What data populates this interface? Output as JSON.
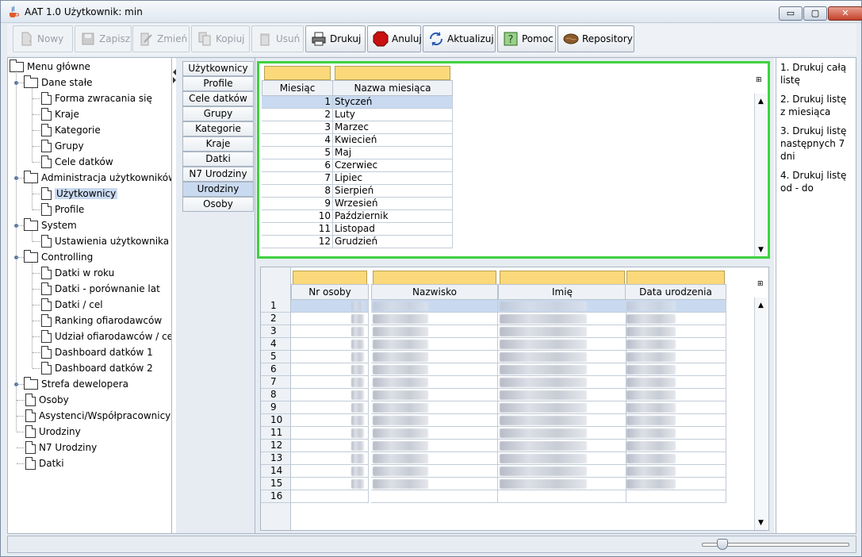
{
  "window": {
    "title": "AAT 1.0  Użytkownik: min",
    "minimize": "▭",
    "maximize": "▢",
    "close": "✕"
  },
  "toolbar": [
    {
      "label": "Nowy",
      "icon": "new-icon",
      "enabled": false
    },
    {
      "label": "Zapisz",
      "icon": "save-icon",
      "enabled": false
    },
    {
      "label": "Zmień",
      "icon": "edit-icon",
      "enabled": false
    },
    {
      "label": "Kopiuj",
      "icon": "copy-icon",
      "enabled": false
    },
    {
      "label": "Usuń",
      "icon": "delete-icon",
      "enabled": false
    },
    {
      "label": "Drukuj",
      "icon": "print-icon",
      "enabled": true
    },
    {
      "label": "Anuluj",
      "icon": "cancel-icon",
      "enabled": true
    },
    {
      "label": "Aktualizuj",
      "icon": "refresh-icon",
      "enabled": true
    },
    {
      "label": "Pomoc",
      "icon": "help-icon",
      "enabled": true
    },
    {
      "label": "Repository",
      "icon": "repository-icon",
      "enabled": true
    }
  ],
  "tree": {
    "root": "Menu główne",
    "groups": [
      {
        "label": "Dane stałe",
        "items": [
          "Forma zwracania się",
          "Kraje",
          "Kategorie",
          "Grupy",
          "Cele datków"
        ]
      },
      {
        "label": "Administracja użytkowników",
        "items": [
          "Użytkownicy",
          "Profile"
        ]
      },
      {
        "label": "System",
        "items": [
          "Ustawienia użytkownika"
        ]
      },
      {
        "label": "Controlling",
        "items": [
          "Datki w roku",
          "Datki - porównanie lat",
          "Datki / cel",
          "Ranking ofiarodawców",
          "Udział ofiarodawców / cel",
          "Dashboard datków 1",
          "Dashboard datków 2"
        ]
      },
      {
        "label": "Strefa dewelopera",
        "items": []
      }
    ],
    "leaves": [
      "Osoby",
      "Asystenci/Współpracownicy",
      "Urodziny",
      "N7 Urodziny",
      "Datki"
    ],
    "selected": "Użytkownicy"
  },
  "tabs": [
    "Użytkownicy",
    "Profile",
    "Cele datków",
    "Grupy",
    "Kategorie",
    "Kraje",
    "Datki",
    "N7 Urodziny",
    "Urodziny",
    "Osoby"
  ],
  "active_tab": "Urodziny",
  "months_table": {
    "columns": [
      "Miesiąc",
      "Nazwa miesiąca"
    ],
    "rows": [
      [
        "1",
        "Styczeń"
      ],
      [
        "2",
        "Luty"
      ],
      [
        "3",
        "Marzec"
      ],
      [
        "4",
        "Kwiecień"
      ],
      [
        "5",
        "Maj"
      ],
      [
        "6",
        "Czerwiec"
      ],
      [
        "7",
        "Lipiec"
      ],
      [
        "8",
        "Sierpień"
      ],
      [
        "9",
        "Wrzesień"
      ],
      [
        "10",
        "Październik"
      ],
      [
        "11",
        "Listopad"
      ],
      [
        "12",
        "Grudzień"
      ]
    ]
  },
  "persons_table": {
    "columns": [
      "Nr osoby",
      "Nazwisko",
      "Imię",
      "Data urodzenia"
    ],
    "row_numbers": [
      "1",
      "2",
      "3",
      "4",
      "5",
      "6",
      "7",
      "8",
      "9",
      "10",
      "11",
      "12",
      "13",
      "14",
      "15",
      "16"
    ]
  },
  "print_options": [
    "1. Drukuj całą listę",
    "2. Drukuj listę z miesiąca",
    "3. Drukuj listę następnych 7 dni",
    "4. Drukuj listę od - do"
  ],
  "colors": {
    "accent_border": "#3fd23f",
    "filter_cell": "#fbd97a",
    "selection": "#c9daf0"
  }
}
